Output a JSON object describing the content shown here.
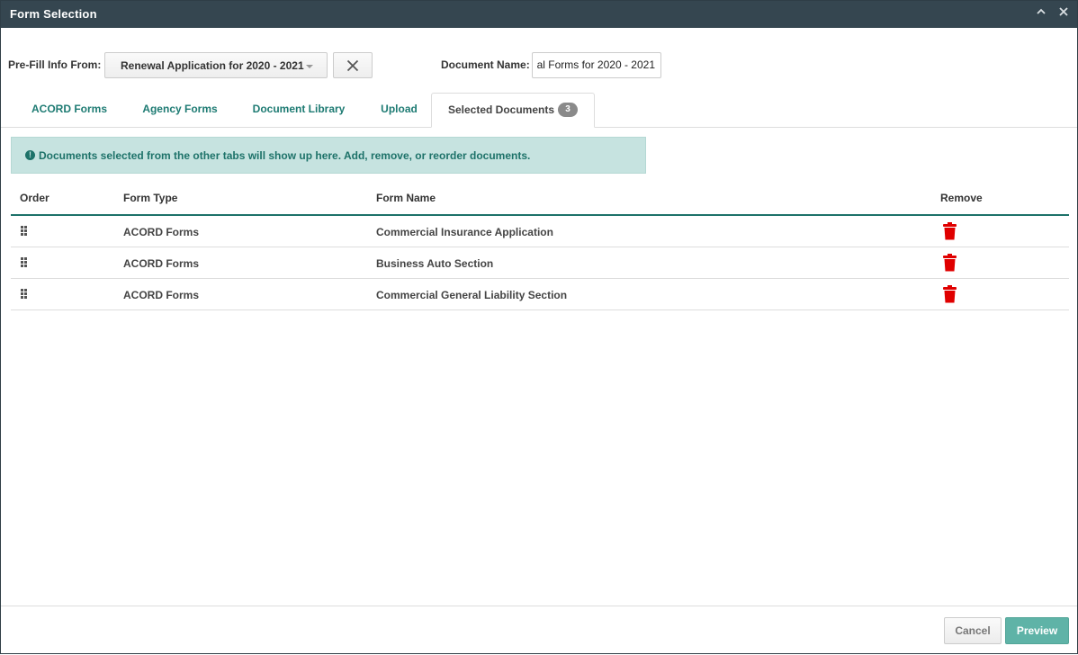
{
  "window": {
    "title": "Form Selection",
    "collapse_icon": "chevron-up-icon",
    "close_icon": "close-icon"
  },
  "prefill": {
    "label": "Pre-Fill Info From:",
    "selected": "Renewal Application for 2020 - 2021",
    "clear_icon": "close-icon"
  },
  "document": {
    "label": "Document Name:",
    "value": "al Forms for 2020 - 2021"
  },
  "tabs": [
    {
      "label": "ACORD Forms"
    },
    {
      "label": "Agency Forms"
    },
    {
      "label": "Document Library"
    },
    {
      "label": "Upload"
    },
    {
      "label": "Selected Documents",
      "badge": "3",
      "active": true
    }
  ],
  "info": {
    "icon": "info-circle-icon",
    "message": "Documents selected from the other tabs will show up here. Add, remove, or reorder documents."
  },
  "grid": {
    "headers": {
      "order": "Order",
      "type": "Form Type",
      "name": "Form Name",
      "remove": "Remove"
    },
    "rows": [
      {
        "type": "ACORD Forms",
        "name": "Commercial Insurance Application"
      },
      {
        "type": "ACORD Forms",
        "name": "Business Auto Section"
      },
      {
        "type": "ACORD Forms",
        "name": "Commercial General Liability Section"
      }
    ],
    "drag_icon": "drag-handle-icon",
    "remove_icon": "trash-icon",
    "remove_color": "#e00000",
    "accent_color": "#1d7269"
  },
  "footer": {
    "cancel_label": "Cancel",
    "preview_label": "Preview",
    "preview_color": "#5fb3a7"
  }
}
